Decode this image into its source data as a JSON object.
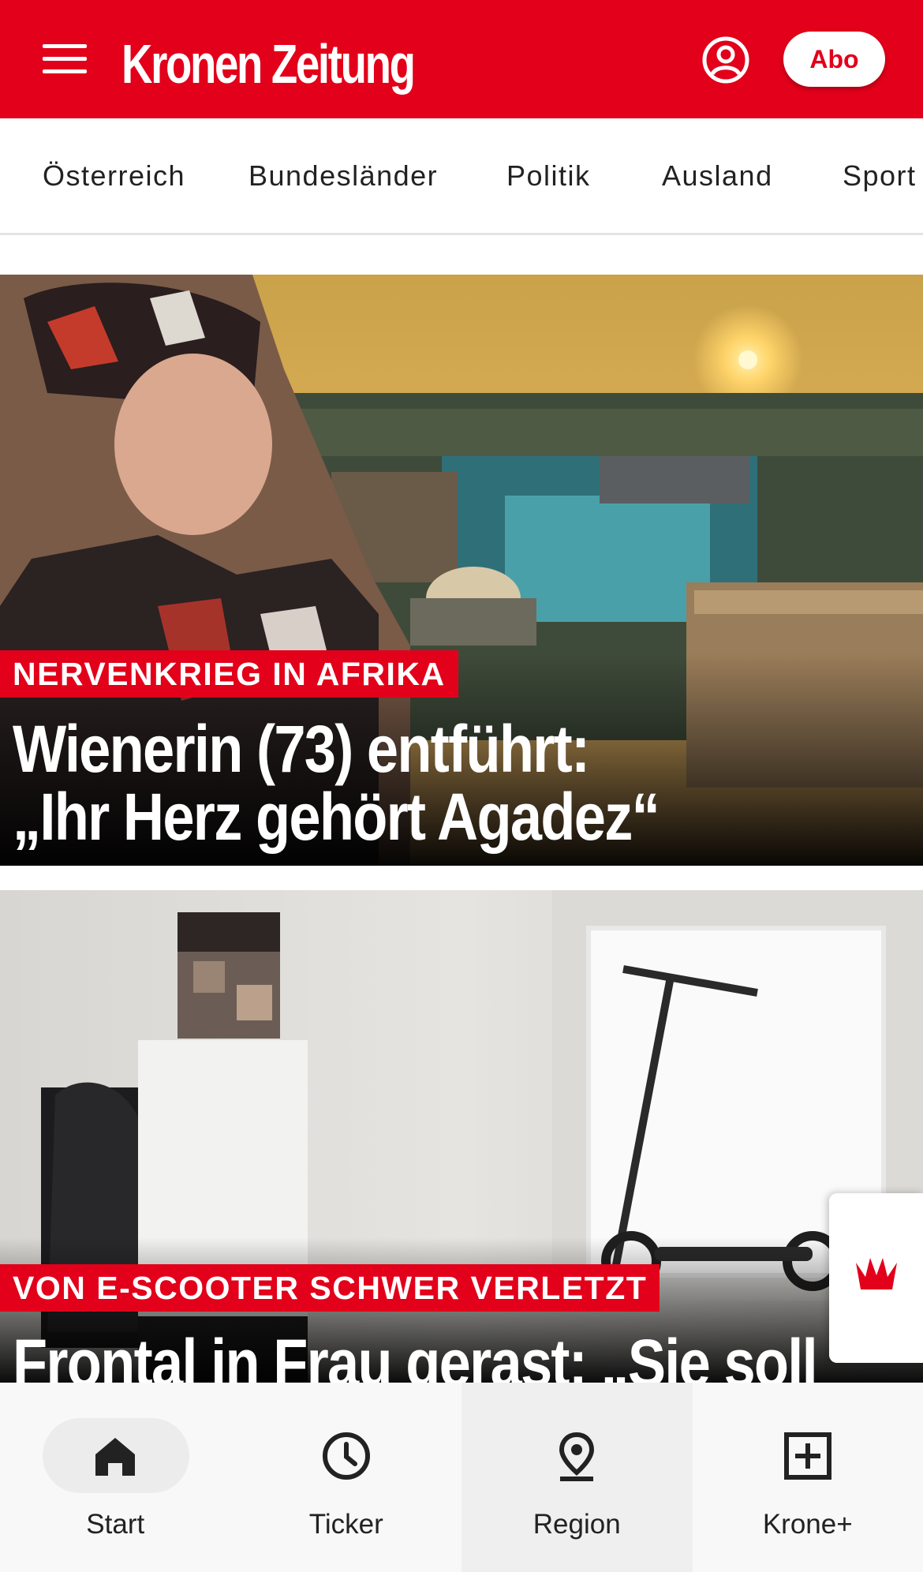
{
  "header": {
    "logo": "Kronen Zeitung",
    "abo_label": "Abo",
    "brand_color": "#e2001a",
    "icons": [
      "menu-icon",
      "account-icon"
    ]
  },
  "nav": {
    "items": [
      {
        "label": "Österreich"
      },
      {
        "label": "Bundesländer"
      },
      {
        "label": "Politik"
      },
      {
        "label": "Ausland"
      },
      {
        "label": "Sport"
      }
    ]
  },
  "articles": [
    {
      "kicker": "NERVENKRIEG IN AFRIKA",
      "headline_lines": [
        "Wienerin (73) entführt:",
        "„Ihr Herz gehört Agadez“"
      ]
    },
    {
      "kicker": "VON E-SCOOTER SCHWER VERLETZT",
      "headline_lines": [
        "Frontal in Frau gerast: „Sie soll"
      ]
    }
  ],
  "floating_widget": {
    "icon": "crown-icon"
  },
  "bottom_nav": {
    "items": [
      {
        "label": "Start",
        "icon": "home-icon",
        "active": true
      },
      {
        "label": "Ticker",
        "icon": "clock-icon",
        "active": false
      },
      {
        "label": "Region",
        "icon": "location-pin-icon",
        "active": false
      },
      {
        "label": "Krone+",
        "icon": "plus-box-icon",
        "active": false
      }
    ]
  }
}
